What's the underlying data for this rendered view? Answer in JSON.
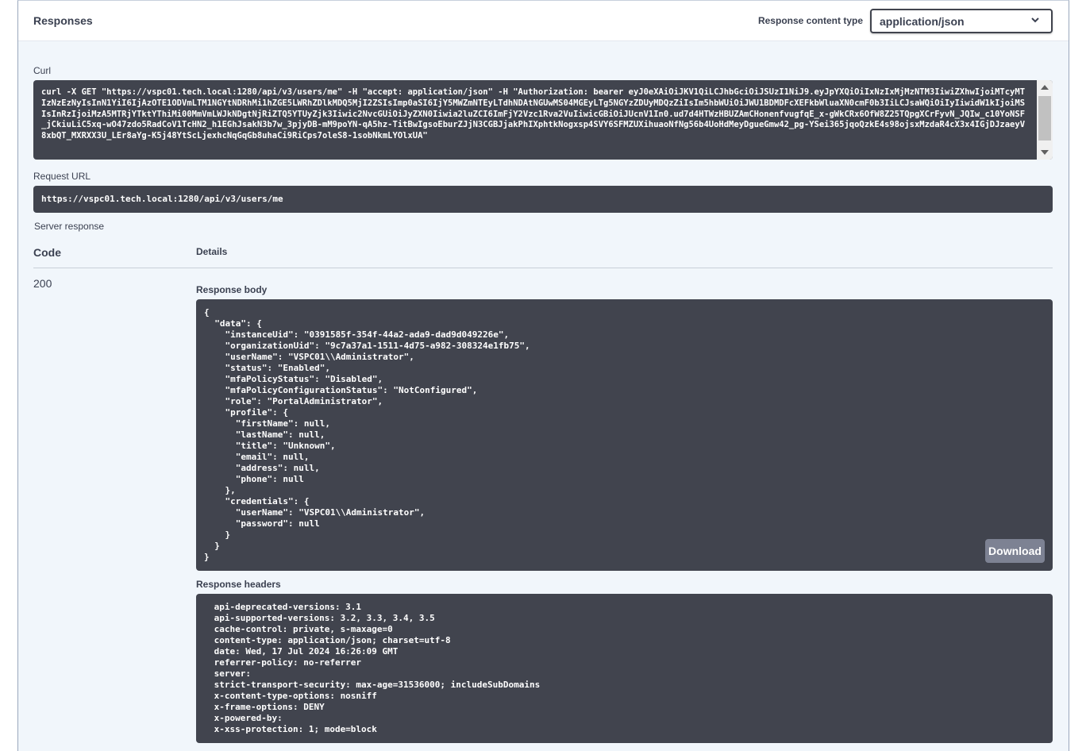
{
  "responses": {
    "title": "Responses",
    "content_type_label": "Response content type",
    "content_type_value": "application/json"
  },
  "curl": {
    "label": "Curl",
    "command": "curl -X GET \"https://vspc01.tech.local:1280/api/v3/users/me\" -H \"accept: application/json\" -H \"Authorization: bearer eyJ0eXAiOiJKV1QiLCJhbGciOiJSUzI1NiJ9.eyJpYXQiOiIxNzIxMjMzNTM3IiwiZXhwIjoiMTcyMTIzNzEzNyIsInN1YiI6IjAzOTE1ODVmLTM1NGYtNDRhMi1hZGE5LWRhZDlkMDQ5MjI2ZSIsImp0aSI6IjY5MWZmNTEyLTdhNDAtNGUwMS04MGEyLTg5NGYzZDUyMDQzZiIsIm5hbWUiOiJWU1BDMDFcXEFkbWluaXN0cmF0b3IiLCJsaWQiOiIyIiwidW1kIjoiMSIsInRzIjoiMzA5MTRjYTktYThiMi00MmVmLWJkNDgtNjRiZTQ5YTUyZjk3Iiwic2NvcGUiOiJyZXN0Iiwia2luZCI6ImFjY2Vzc1Rva2VuIiwicGBiOiJUcnV1In0.ud7d4HTWzHBUZAmCHonenfvugfqE_x-gWkCRx6OfW8Z25TQpgXCrFyvN_JQIw_c10YoNSF_jCkiuLiC5xq-wO47zdo5RadCoV1TcHN2_h1EGhJsakN3b7w_3pjyDB-mM9poYN-qA5hz-TitBwIgsoEburZJjN3CGBJjakPhIXphtkNogxsp4SVY6SFMZUXihuaoNfNg56b4UoHdMeyDgueGmw42_pg-YSei365jqoQzkE4s98ojsxMzdaR4cX3x4IGjDJzaeyV8xbQT_MXRXX3U_LEr8aYg-K5j48YtScLjexhcNqGqGb8uhaCi9RiCps7oleS8-1sobNkmLYOlxUA\""
  },
  "request_url": {
    "label": "Request URL",
    "value": "https://vspc01.tech.local:1280/api/v3/users/me"
  },
  "server_response": {
    "label": "Server response",
    "col_code": "Code",
    "col_details": "Details",
    "code": "200",
    "body_label": "Response body",
    "body": "{\n  \"data\": {\n    \"instanceUid\": \"0391585f-354f-44a2-ada9-dad9d049226e\",\n    \"organizationUid\": \"9c7a37a1-1511-4d75-a982-308324e1fb75\",\n    \"userName\": \"VSPC01\\\\Administrator\",\n    \"status\": \"Enabled\",\n    \"mfaPolicyStatus\": \"Disabled\",\n    \"mfaPolicyConfigurationStatus\": \"NotConfigured\",\n    \"role\": \"PortalAdministrator\",\n    \"profile\": {\n      \"firstName\": null,\n      \"lastName\": null,\n      \"title\": \"Unknown\",\n      \"email\": null,\n      \"address\": null,\n      \"phone\": null\n    },\n    \"credentials\": {\n      \"userName\": \"VSPC01\\\\Administrator\",\n      \"password\": null\n    }\n  }\n}",
    "download_label": "Download",
    "headers_label": "Response headers",
    "headers": " api-deprecated-versions: 3.1 \n api-supported-versions: 3.2, 3.3, 3.4, 3.5 \n cache-control: private, s-maxage=0 \n content-type: application/json; charset=utf-8 \n date: Wed, 17 Jul 2024 16:26:09 GMT \n referrer-policy: no-referrer \n server: \n strict-transport-security: max-age=31536000; includeSubDomains \n x-content-type-options: nosniff \n x-frame-options: DENY \n x-powered-by: \n x-xss-protection: 1; mode=block "
  },
  "icons": {
    "select_chevron": "chevron-down-icon",
    "scroll_up": "arrow-up-icon",
    "scroll_down": "arrow-down-icon"
  },
  "colors": {
    "code_bg": "#41444e",
    "panel_bg": "#f1f6fb",
    "download_bg": "#7d8293"
  }
}
